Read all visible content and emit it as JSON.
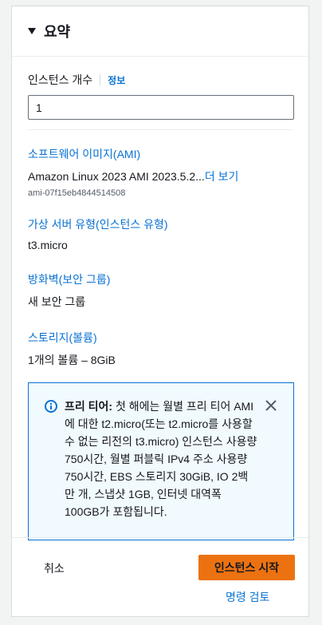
{
  "panel": {
    "title": "요약"
  },
  "instances": {
    "label": "인스턴스 개수",
    "info": "정보",
    "value": "1"
  },
  "software_image": {
    "title": "소프트웨어 이미지(AMI)",
    "value": "Amazon Linux 2023 AMI 2023.5.2...",
    "more": "더 보기",
    "ami_id": "ami-07f15eb4844514508"
  },
  "instance_type": {
    "title": "가상 서버 유형(인스턴스 유형)",
    "value": "t3.micro"
  },
  "firewall": {
    "title": "방화벽(보안 그룹)",
    "value": "새 보안 그룹"
  },
  "storage": {
    "title": "스토리지(볼륨)",
    "value": "1개의 볼륨 – 8GiB"
  },
  "free_tier_alert": {
    "bold": "프리 티어:",
    "text": " 첫 해에는 월별 프리 티어 AMI 에 대한 t2.micro(또는 t2.micro를 사용할 수 없는 리전의 t3.micro) 인스턴스 사용량 750시간, 월별 퍼블릭 IPv4 주소 사용량 750시간, EBS 스토리지 30GiB, IO 2백만 개, 스냅샷 1GB, 인터넷 대역폭 100GB가 포함됩니다.",
    "icon": "info-icon",
    "close_icon": "close-icon"
  },
  "footer": {
    "cancel": "취소",
    "launch": "인스턴스 시작",
    "review": "명령 검토"
  },
  "colors": {
    "accent_link": "#0972d3",
    "primary_button": "#ec7211",
    "alert_bg": "#f1faff"
  }
}
